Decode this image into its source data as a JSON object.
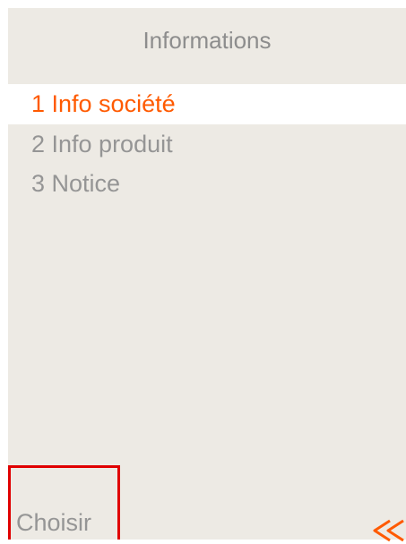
{
  "screen": {
    "title": "Informations"
  },
  "menu": {
    "items": [
      {
        "label": "1 Info société",
        "selected": true
      },
      {
        "label": "2 Info produit",
        "selected": false
      },
      {
        "label": "3 Notice",
        "selected": false
      }
    ]
  },
  "softkeys": {
    "left_label": "Choisir",
    "right_icon": "back-double-chevron-icon"
  },
  "colors": {
    "background": "#edeae4",
    "selected_text": "#ff5a00",
    "normal_text": "#959595",
    "highlight_border": "#e00000"
  }
}
